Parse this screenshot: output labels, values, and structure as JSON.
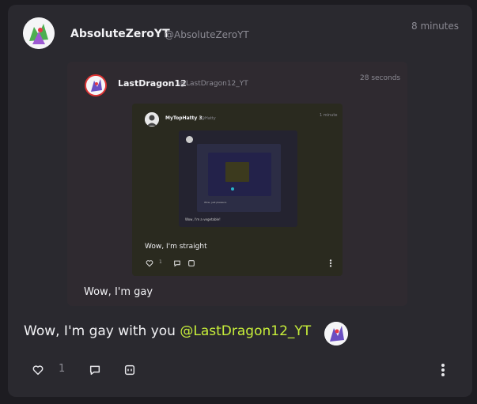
{
  "post": {
    "author_name": "AbsoluteZeroYT",
    "author_handle": "@AbsoluteZeroYT",
    "timestamp": "8 minutes",
    "text": "Wow, I'm gay with you",
    "mention": "@LastDragon12_YT",
    "like_count": "1"
  },
  "quote1": {
    "author_name": "LastDragon12",
    "author_handle": "@LastDragon12_YT",
    "timestamp": "28 seconds",
    "text": "Wow, I'm gay"
  },
  "quote2": {
    "author_name": "MyTopHatty 3",
    "author_handle": "@Hatty",
    "timestamp": "1 minute",
    "text": "Wow, I'm straight",
    "like_count": "1"
  },
  "quote3": {
    "text": "Wow, I'm a vegetable!"
  },
  "quote4": {
    "text": "Wow, just pleasure"
  },
  "colors": {
    "background": "#1d1c21",
    "card": "#2a292f",
    "accent_mention": "#c8ef3a"
  },
  "icons": [
    "heart-icon",
    "comment-icon",
    "quote-icon",
    "more-vertical-icon"
  ]
}
